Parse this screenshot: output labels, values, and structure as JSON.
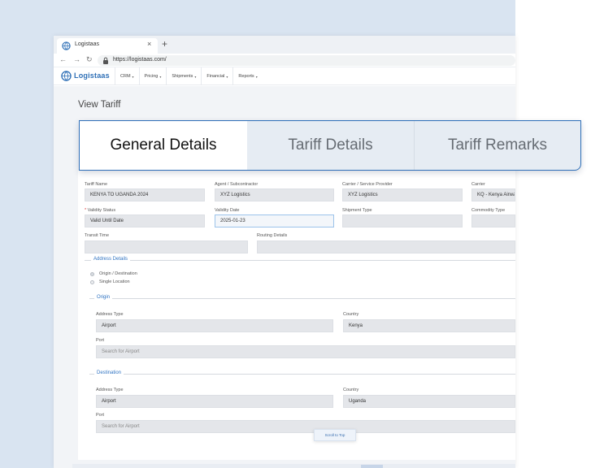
{
  "browser": {
    "tab_title": "Logistaas",
    "tab_close": "×",
    "new_tab": "+",
    "url": "https://logistaas.com/",
    "back": "←",
    "forward": "→",
    "reload": "↻"
  },
  "app": {
    "logo_text": "Logistaas",
    "menu": [
      {
        "label": "CRM"
      },
      {
        "label": "Pricing"
      },
      {
        "label": "Shipments"
      },
      {
        "label": "Financial"
      },
      {
        "label": "Reports"
      }
    ],
    "caret": "▾"
  },
  "page": {
    "title": "View Tariff",
    "tabs": [
      {
        "label": "General Details",
        "active": true
      },
      {
        "label": "Tariff Details",
        "active": false
      },
      {
        "label": "Tariff Remarks",
        "active": false
      }
    ]
  },
  "form": {
    "tariff_name": {
      "label": "Tariff Name",
      "value": "KENYA TO UGANDA 2024"
    },
    "agent": {
      "label": "Agent / Subcontractor",
      "value": "XYZ Logistics"
    },
    "carrier_provider": {
      "label": "Carrier / Service Provider",
      "value": "XYZ Logistics"
    },
    "carrier": {
      "label": "Carrier",
      "value": "KQ - Kenya Airways"
    },
    "validity_status": {
      "required_mark": "*",
      "label": "Validity Status",
      "value": "Valid Until Date"
    },
    "validity_date": {
      "label": "Validity Date",
      "value": "2025-01-23"
    },
    "shipment_type": {
      "label": "Shipment Type",
      "value": ""
    },
    "commodity_type": {
      "label": "Commodity Type",
      "value": ""
    },
    "transit_time": {
      "label": "Transit Time",
      "value": ""
    },
    "routing_details": {
      "label": "Routing Details",
      "value": ""
    }
  },
  "address": {
    "section_title": "Address Details",
    "options": [
      {
        "label": "Origin / Destination",
        "selected": true
      },
      {
        "label": "Single Location",
        "selected": false
      }
    ],
    "origin": {
      "title": "Origin",
      "address_type_label": "Address Type",
      "address_type_value": "Airport",
      "country_label": "Country",
      "country_value": "Kenya",
      "port_label": "Port",
      "port_placeholder": "Search for Airport"
    },
    "destination": {
      "title": "Destination",
      "address_type_label": "Address Type",
      "address_type_value": "Airport",
      "country_label": "Country",
      "country_value": "Uganda",
      "port_label": "Port",
      "port_placeholder": "Search for Airport"
    }
  },
  "scroll_to_top": "Scroll to Top",
  "colors": {
    "accent": "#2f73c2",
    "background": "#d9e4f1"
  }
}
